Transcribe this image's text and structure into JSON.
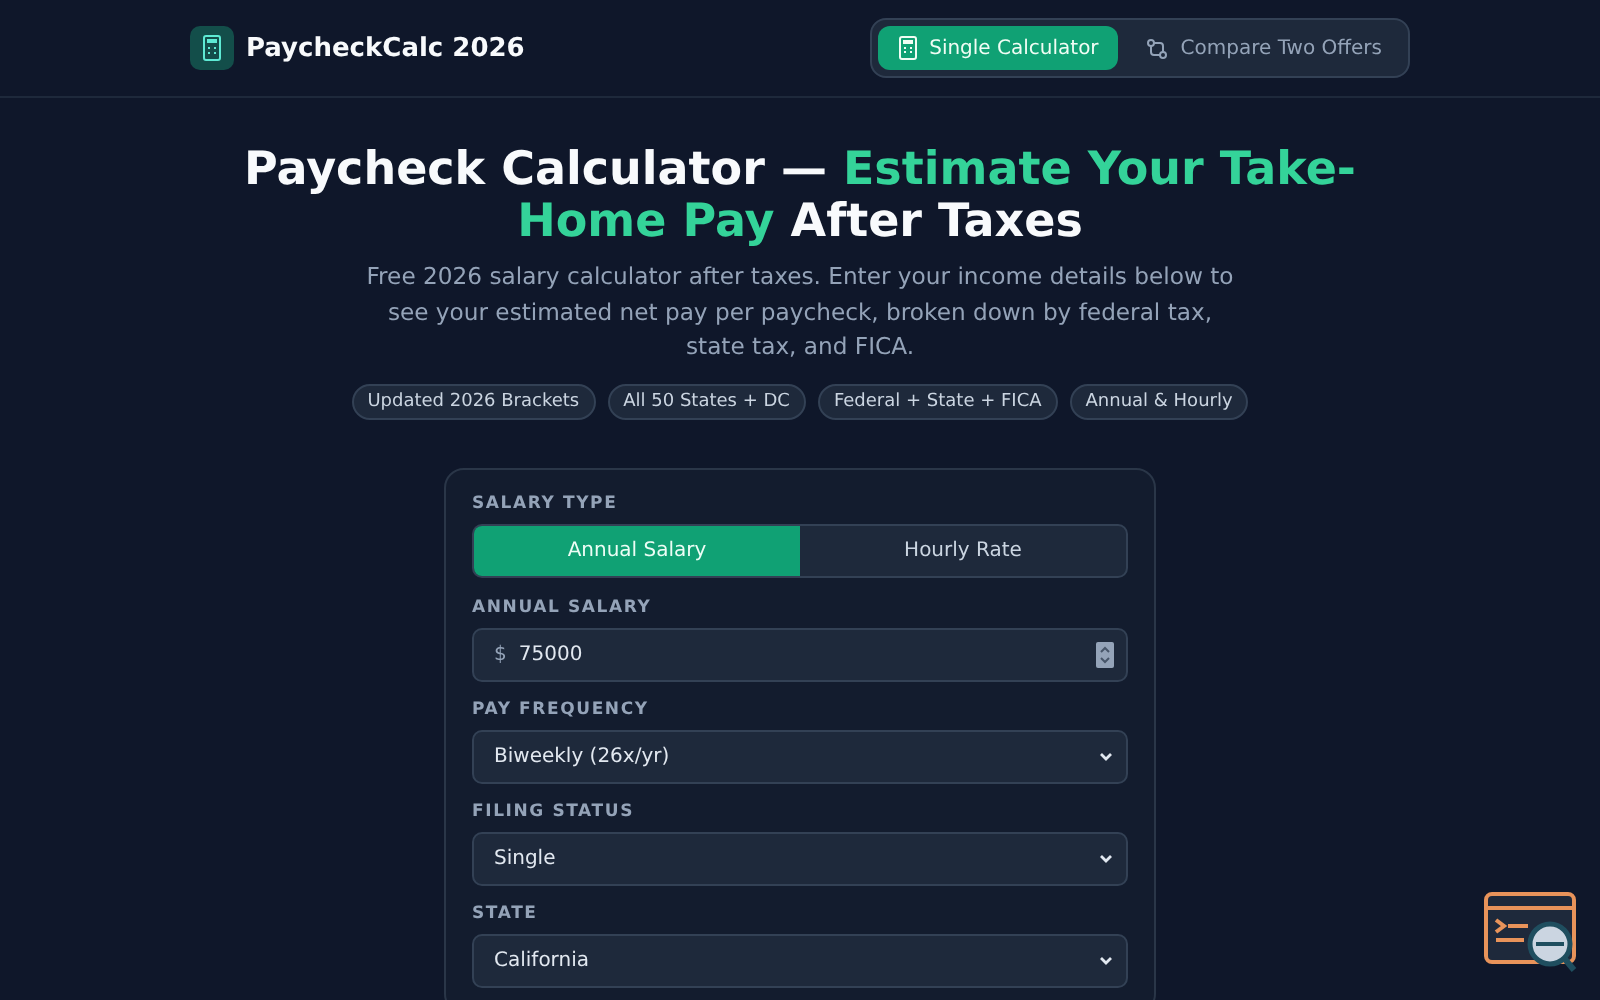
{
  "header": {
    "brand": "PaycheckCalc 2026",
    "nav": [
      {
        "label": "Single Calculator",
        "selected": true
      },
      {
        "label": "Compare Two Offers",
        "selected": false
      }
    ]
  },
  "hero": {
    "title_parts": [
      {
        "text": "Paycheck Calculator — ",
        "accent": false
      },
      {
        "text": "Estimate Your Take-Home Pay",
        "accent": true
      },
      {
        "text": " After Taxes",
        "accent": false
      }
    ],
    "subtitle": "Free 2026 salary calculator after taxes. Enter your income details below to see your estimated net pay per paycheck, broken down by federal tax, state tax, and FICA.",
    "badges": [
      "Updated 2026 Brackets",
      "All 50 States + DC",
      "Federal + State + FICA",
      "Annual & Hourly"
    ]
  },
  "form": {
    "salary_type": {
      "label": "SALARY TYPE",
      "options": [
        {
          "label": "Annual Salary",
          "selected": true
        },
        {
          "label": "Hourly Rate",
          "selected": false
        }
      ]
    },
    "fields": [
      {
        "kind": "number",
        "label": "ANNUAL SALARY",
        "prefix": "$",
        "value": "75000"
      },
      {
        "kind": "select",
        "label": "PAY FREQUENCY",
        "value": "Biweekly (26x/yr)"
      },
      {
        "kind": "select",
        "label": "FILING STATUS",
        "value": "Single"
      },
      {
        "kind": "select",
        "label": "STATE",
        "value": "California"
      }
    ]
  }
}
